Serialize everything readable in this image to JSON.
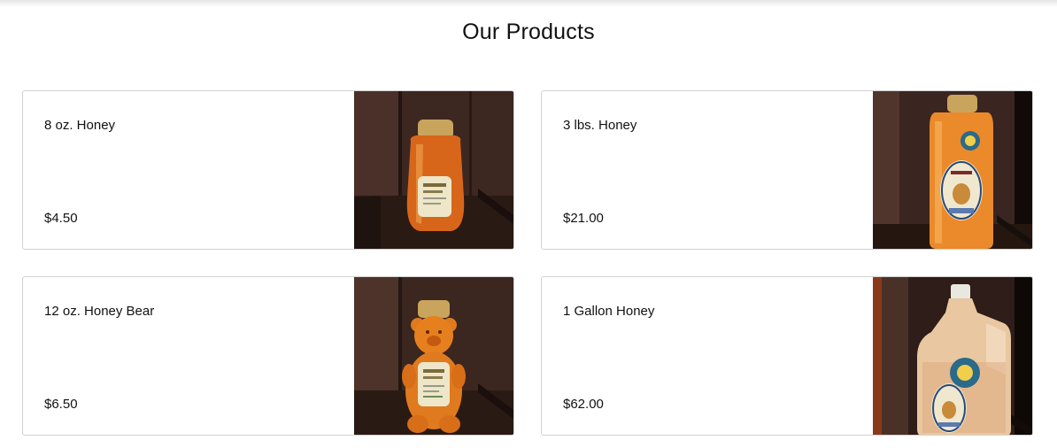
{
  "page": {
    "title": "Our Products"
  },
  "products": [
    {
      "name": "8 oz. Honey",
      "price": "$4.50",
      "image": "honey-bottle-8oz-photo"
    },
    {
      "name": "3 lbs. Honey",
      "price": "$21.00",
      "image": "honey-jar-3lbs-photo"
    },
    {
      "name": "12 oz. Honey Bear",
      "price": "$6.50",
      "image": "honey-bear-12oz-photo"
    },
    {
      "name": "1 Gallon Honey",
      "price": "$62.00",
      "image": "honey-gallon-jug-photo"
    }
  ],
  "colors": {
    "honey": "#e07a1e",
    "honey_light": "#f0a040",
    "wood_dark": "#2b1a14",
    "wood_mid": "#4a3027",
    "cap_gold": "#c9a45c"
  }
}
